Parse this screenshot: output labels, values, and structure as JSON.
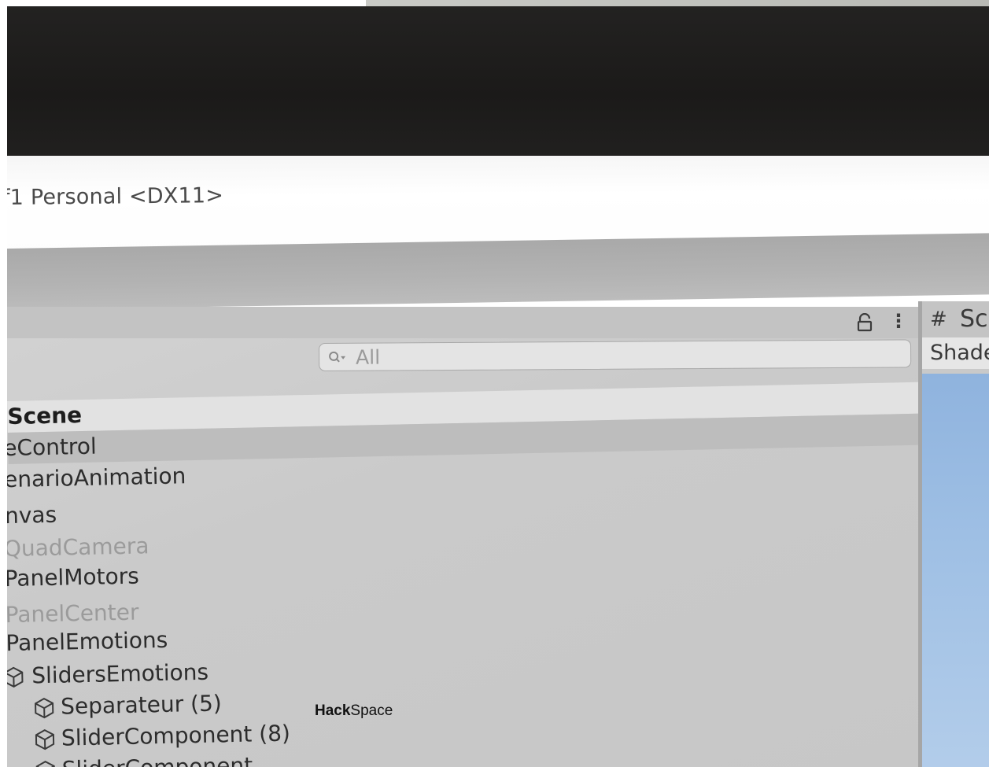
{
  "window": {
    "title": "f1 Personal <DX11>"
  },
  "hierarchy": {
    "search": {
      "placeholder": "All"
    },
    "items": [
      {
        "label": "Scene",
        "type": "scene"
      },
      {
        "label": "eControl",
        "type": "selected"
      },
      {
        "label": "enarioAnimation",
        "type": "normal"
      },
      {
        "label": "nvas",
        "type": "normal"
      },
      {
        "label": "QuadCamera",
        "type": "disabled"
      },
      {
        "label": "PanelMotors",
        "type": "normal"
      },
      {
        "label": "PanelCenter",
        "type": "disabled"
      },
      {
        "label": "PanelEmotions",
        "type": "normal"
      },
      {
        "label": "SlidersEmotions",
        "type": "normal",
        "icon": "cube-icon"
      },
      {
        "label": "Separateur (5)",
        "type": "normal",
        "icon": "cube-icon"
      },
      {
        "label": "SliderComponent (8)",
        "type": "normal",
        "icon": "cube-icon"
      },
      {
        "label": "SliderComponent",
        "type": "normal",
        "icon": "cube-icon"
      }
    ],
    "icons": {
      "lock": "lock-icon",
      "menu": "vertical-dots-icon",
      "search": "search-icon",
      "game_object": "cube-icon"
    }
  },
  "inspector": {
    "tab_icon": "#",
    "tab_label": "Sc",
    "shader_label": "Shade"
  },
  "watermark": {
    "bold": "Hack",
    "regular": "Space"
  },
  "colors": {
    "bezel": "#1c1b1a",
    "panel": "#cacaca",
    "scene_header": "#e2e2e2",
    "selected_row": "#bdbdbd",
    "scene_view_sky": "#9ebfe4"
  }
}
